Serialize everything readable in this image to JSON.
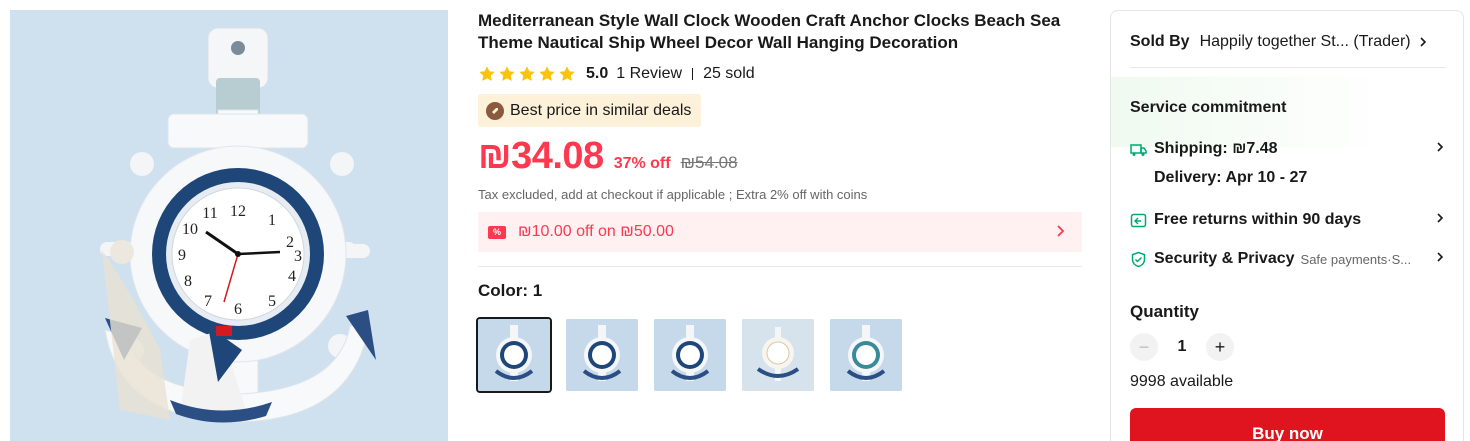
{
  "product": {
    "title": "Mediterranean Style Wall Clock Wooden Craft Anchor Clocks Beach Sea Theme Nautical Ship Wheel Decor Wall Hanging Decoration",
    "rating": {
      "stars": 5,
      "score": "5.0",
      "reviews": "1 Review",
      "sold": "25 sold"
    },
    "badge": "Best price in similar deals",
    "price": "₪34.08",
    "discount": "37% off",
    "original_price": "₪54.08",
    "tax_note": "Tax excluded, add at checkout if applicable ; Extra 2% off with coins",
    "coupon": {
      "icon_text": "%",
      "text": "₪10.00 off on ₪50.00"
    },
    "color_label": "Color: 1",
    "variants": [
      "1",
      "2",
      "3",
      "4",
      "5"
    ],
    "selected_variant": 0
  },
  "seller": {
    "label": "Sold By",
    "name": "Happily together St... (Trader)"
  },
  "service": {
    "title": "Service commitment",
    "shipping": "Shipping: ₪7.48",
    "delivery": "Delivery: Apr 10 - 27",
    "returns": "Free returns within 90 days",
    "security": "Security & Privacy",
    "security_sub": "Safe payments·S..."
  },
  "quantity": {
    "label": "Quantity",
    "value": "1",
    "available": "9998 available"
  },
  "buy_button": "Buy now",
  "colors": {
    "accent": "#fd384f",
    "buy": "#e0141e",
    "star": "#fcc30b",
    "green": "#01a971"
  }
}
